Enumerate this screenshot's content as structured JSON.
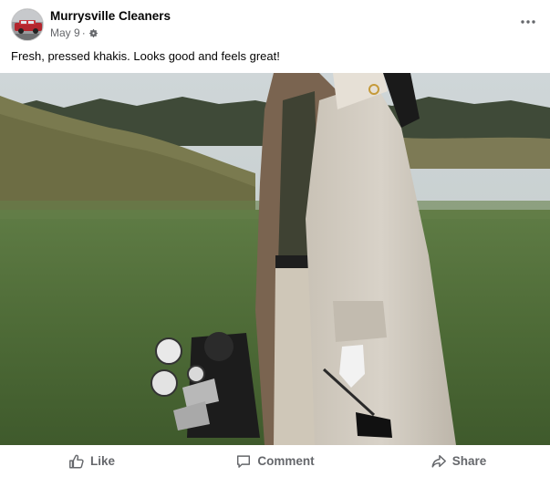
{
  "post": {
    "page_name": "Murrysville Cleaners",
    "date": "May 9",
    "separator": "·",
    "audience_icon": "gear-icon",
    "text": "Fresh, pressed khakis. Looks good and feels great!",
    "more_icon": "more-horizontal-icon"
  },
  "actions": [
    {
      "label": "Like",
      "icon": "thumbs-up-icon"
    },
    {
      "label": "Comment",
      "icon": "comment-icon"
    },
    {
      "label": "Share",
      "icon": "share-icon"
    }
  ],
  "colors": {
    "text_primary": "#050505",
    "text_secondary": "#65676b",
    "background": "#ffffff"
  }
}
